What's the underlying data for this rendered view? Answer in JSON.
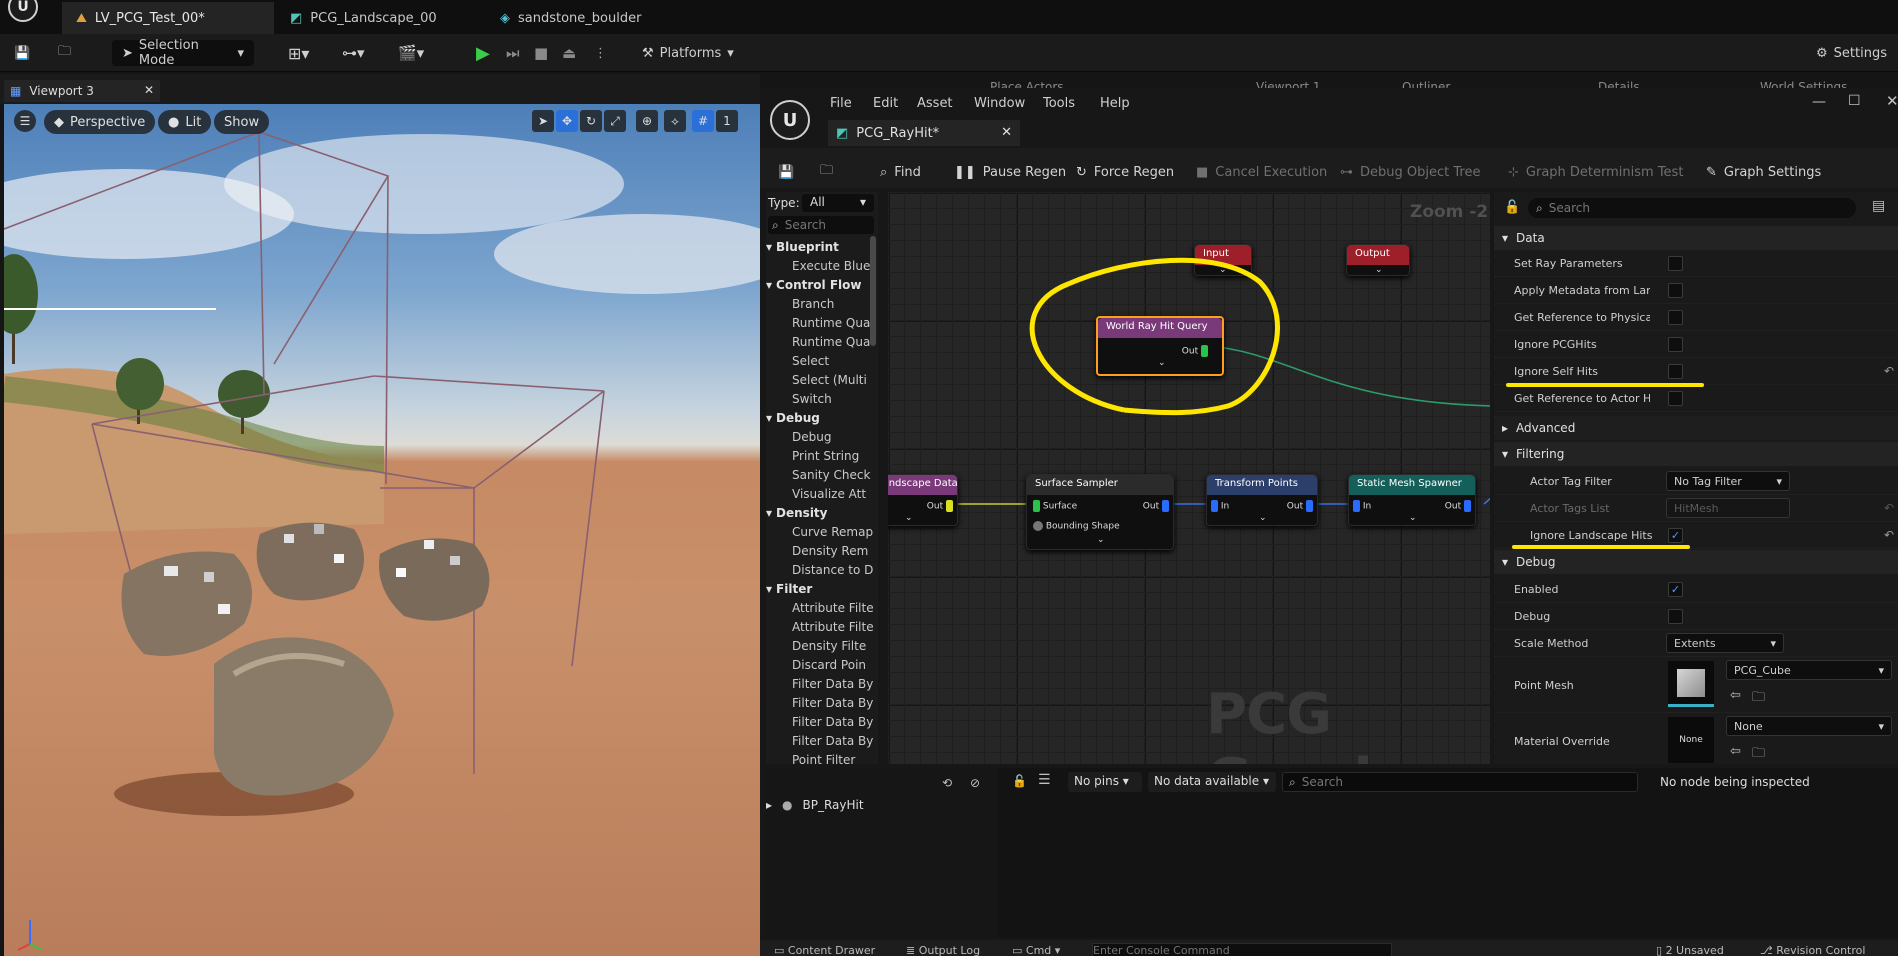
{
  "tabs": [
    {
      "label": "LV_PCG_Test_00*",
      "active": true
    },
    {
      "label": "PCG_Landscape_00",
      "active": false
    },
    {
      "label": "sandstone_boulder",
      "active": false
    }
  ],
  "toolbar": {
    "selection_mode": "Selection Mode",
    "platforms": "Platforms",
    "settings": "Settings"
  },
  "viewport": {
    "tab_label": "Viewport 3",
    "perspective": "Perspective",
    "lit": "Lit",
    "show": "Show",
    "grid_value": "1"
  },
  "ghost_tabs": [
    "Place Actors",
    "Viewport 1",
    "Outliner",
    "Details",
    "World Settings"
  ],
  "pcg_window": {
    "menus": [
      "File",
      "Edit",
      "Asset",
      "Window",
      "Tools",
      "Help"
    ],
    "doc_tab": "PCG_RayHit*",
    "toolbar": {
      "find": "Find",
      "pause_regen": "Pause Regen",
      "force_regen": "Force Regen",
      "cancel_execution": "Cancel Execution",
      "debug_object_tree": "Debug Object Tree",
      "graph_determinism_test": "Graph Determinism Test",
      "graph_settings": "Graph Settings"
    }
  },
  "palette": {
    "type_label": "Type:",
    "type_value": "All",
    "search_placeholder": "Search",
    "categories": [
      {
        "name": "Blueprint",
        "items": [
          "Execute Blue"
        ]
      },
      {
        "name": "Control Flow",
        "items": [
          "Branch",
          "Runtime Qua",
          "Runtime Qua",
          "Select",
          "Select (Multi",
          "Switch"
        ]
      },
      {
        "name": "Debug",
        "items": [
          "Debug",
          "Print String",
          "Sanity Check",
          "Visualize Att"
        ]
      },
      {
        "name": "Density",
        "items": [
          "Curve Remap",
          "Density Rem",
          "Distance to D"
        ]
      },
      {
        "name": "Filter",
        "items": [
          "Attribute Filte",
          "Attribute Filte",
          "Density Filte",
          "Discard Poin",
          "Filter Data By",
          "Filter Data By",
          "Filter Data By",
          "Filter Data By",
          "Point Filter"
        ]
      }
    ]
  },
  "graph": {
    "zoom": "Zoom -2",
    "watermark": "PCG Graph",
    "nodes": {
      "input": "Input",
      "output": "Output",
      "world_ray_hit_query": "World Ray Hit Query",
      "landscape_data": "Landscape Data",
      "surface_sampler": "Surface Sampler",
      "transform_points": "Transform Points",
      "static_mesh_spawner": "Static Mesh Spawner"
    },
    "pins": {
      "out": "Out",
      "in": "In",
      "surface": "Surface",
      "bounding_shape": "Bounding Shape"
    }
  },
  "details": {
    "search_placeholder": "Search",
    "sections": {
      "data": "Data",
      "advanced": "Advanced",
      "filtering": "Filtering",
      "debug": "Debug"
    },
    "data_rows": [
      {
        "label": "Set Ray Parameters",
        "checked": false
      },
      {
        "label": "Apply Metadata from Lan...",
        "checked": false
      },
      {
        "label": "Get Reference to Physical...",
        "checked": false
      },
      {
        "label": "Ignore PCGHits",
        "checked": false
      },
      {
        "label": "Ignore Self Hits",
        "checked": false
      },
      {
        "label": "Get Reference to Actor Hit",
        "checked": false
      }
    ],
    "filtering": {
      "actor_tag_filter_label": "Actor Tag Filter",
      "actor_tag_filter_value": "No Tag Filter",
      "actor_tags_list_label": "Actor Tags List",
      "actor_tags_list_value": "HitMesh",
      "ignore_landscape_label": "Ignore Landscape Hits",
      "ignore_landscape_checked": true
    },
    "debug": {
      "enabled_label": "Enabled",
      "enabled_checked": true,
      "debug_label": "Debug",
      "debug_checked": false,
      "scale_method_label": "Scale Method",
      "scale_method_value": "Extents",
      "point_mesh_label": "Point Mesh",
      "point_mesh_value": "PCG_Cube",
      "material_override_label": "Material Override",
      "material_override_value": "None",
      "material_thumb_text": "None"
    }
  },
  "inspector": {
    "pins_combo": "No pins",
    "data_combo": "No data available",
    "search_placeholder": "Search",
    "status": "No node being inspected",
    "tree_item": "BP_RayHit"
  },
  "statusbar": {
    "content_drawer": "Content Drawer",
    "output_log": "Output Log",
    "cmd": "Cmd",
    "console_placeholder": "Enter Console Command",
    "unsaved": "2 Unsaved",
    "revision_control": "Revision Control"
  },
  "colors": {
    "accent": "#2b8fff",
    "highlight_annotation": "#ffe600",
    "pin_green": "#29c24a",
    "pin_yellow": "#d8e023",
    "pin_blue": "#2a6bff"
  }
}
